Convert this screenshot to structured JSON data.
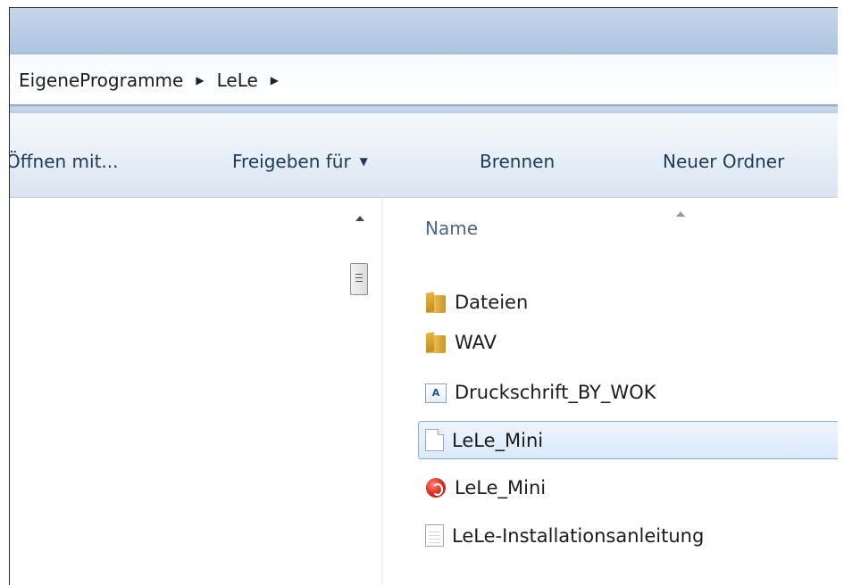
{
  "breadcrumb": {
    "items": [
      "EigeneProgramme",
      "LeLe"
    ],
    "separator": "▶"
  },
  "toolbar": {
    "open_with": "Öffnen mit...",
    "share_with": "Freigeben für",
    "burn": "Brennen",
    "new_folder": "Neuer Ordner"
  },
  "columns": {
    "name": "Name"
  },
  "files": [
    {
      "name": "Dateien",
      "icon": "folder-icon"
    },
    {
      "name": "WAV",
      "icon": "folder-icon"
    },
    {
      "name": "Druckschrift_BY_WOK",
      "icon": "font-file-icon"
    },
    {
      "name": "LeLe_Mini",
      "icon": "blank-document-icon",
      "selected": true
    },
    {
      "name": "LeLe_Mini",
      "icon": "application-icon"
    },
    {
      "name": "LeLe-Installationsanleitung",
      "icon": "text-document-icon"
    }
  ],
  "colors": {
    "selection": "#dae9fb",
    "selection_border": "#84acdd",
    "toolbar_text": "#1e395b"
  }
}
